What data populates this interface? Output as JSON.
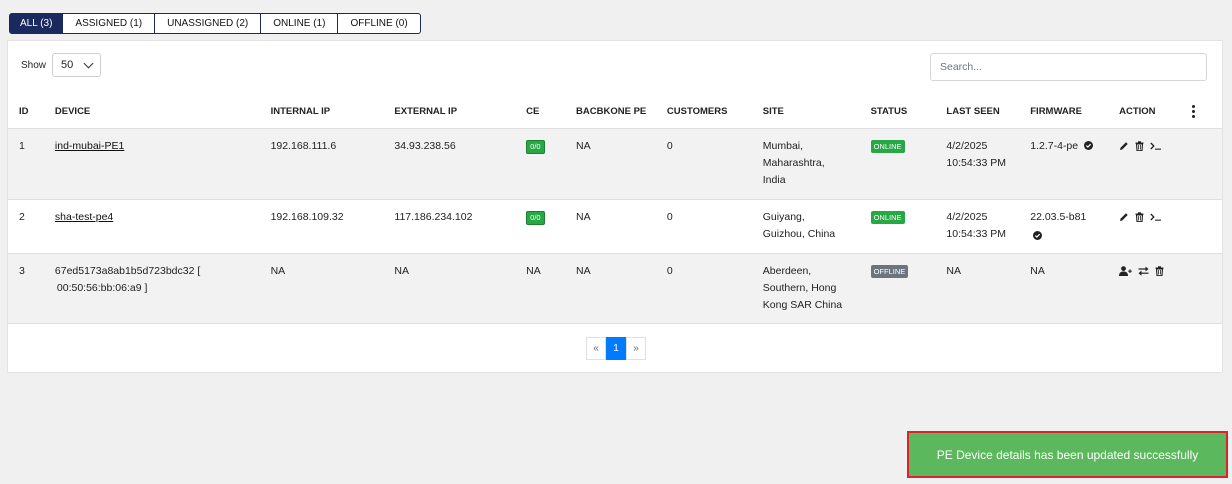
{
  "filter_tabs": [
    {
      "label": "ALL (3)",
      "active": true
    },
    {
      "label": "ASSIGNED (1)",
      "active": false
    },
    {
      "label": "UNASSIGNED (2)",
      "active": false
    },
    {
      "label": "ONLINE (1)",
      "active": false
    },
    {
      "label": "OFFLINE (0)",
      "active": false
    }
  ],
  "show": {
    "label": "Show",
    "value": "50"
  },
  "search": {
    "placeholder": "Search..."
  },
  "table": {
    "headers": [
      "ID",
      "DEVICE",
      "INTERNAL IP",
      "EXTERNAL IP",
      "CE",
      "BACBKONE PE",
      "CUSTOMERS",
      "SITE",
      "STATUS",
      "LAST SEEN",
      "FIRMWARE",
      "ACTION"
    ],
    "rows": [
      {
        "id": "1",
        "device": "ind-mubai-PE1",
        "device_sub": "",
        "internal_ip": "192.168.111.6",
        "external_ip": "34.93.238.56",
        "ce": "0/0",
        "backbone_pe": "NA",
        "customers": "0",
        "site_l1": "Mumbai,",
        "site_l2": "Maharashtra,",
        "site_l3": "India",
        "status": "ONLINE",
        "last_seen_date": "4/2/2025",
        "last_seen_time": "10:54:33 PM",
        "firmware": "1.2.7-4-pe"
      },
      {
        "id": "2",
        "device": "sha-test-pe4",
        "device_sub": "",
        "internal_ip": "192.168.109.32",
        "external_ip": "117.186.234.102",
        "ce": "0/0",
        "backbone_pe": "NA",
        "customers": "0",
        "site_l1": "Guiyang,",
        "site_l2": "Guizhou, China",
        "site_l3": "",
        "status": "ONLINE",
        "last_seen_date": "4/2/2025",
        "last_seen_time": "10:54:33 PM",
        "firmware": "22.03.5-b81"
      },
      {
        "id": "3",
        "device": "67ed5173a8ab1b5d723bdc32 [",
        "device_sub": "00:50:56:bb:06:a9 ]",
        "internal_ip": "NA",
        "external_ip": "NA",
        "ce": "NA",
        "backbone_pe": "NA",
        "customers": "0",
        "site_l1": "Aberdeen,",
        "site_l2": "Southern, Hong",
        "site_l3": "Kong SAR China",
        "status": "OFFLINE",
        "last_seen_date": "NA",
        "last_seen_time": "",
        "firmware": "NA"
      }
    ]
  },
  "pagination": {
    "prev": "«",
    "current": "1",
    "next": "»"
  },
  "toast": {
    "message": "PE Device details has been updated successfully"
  },
  "colors": {
    "primary": "#1a2a5e",
    "online": "#28a745",
    "offline": "#6c757d",
    "toast": "#5cb85c",
    "highlight": "#d9232d"
  }
}
